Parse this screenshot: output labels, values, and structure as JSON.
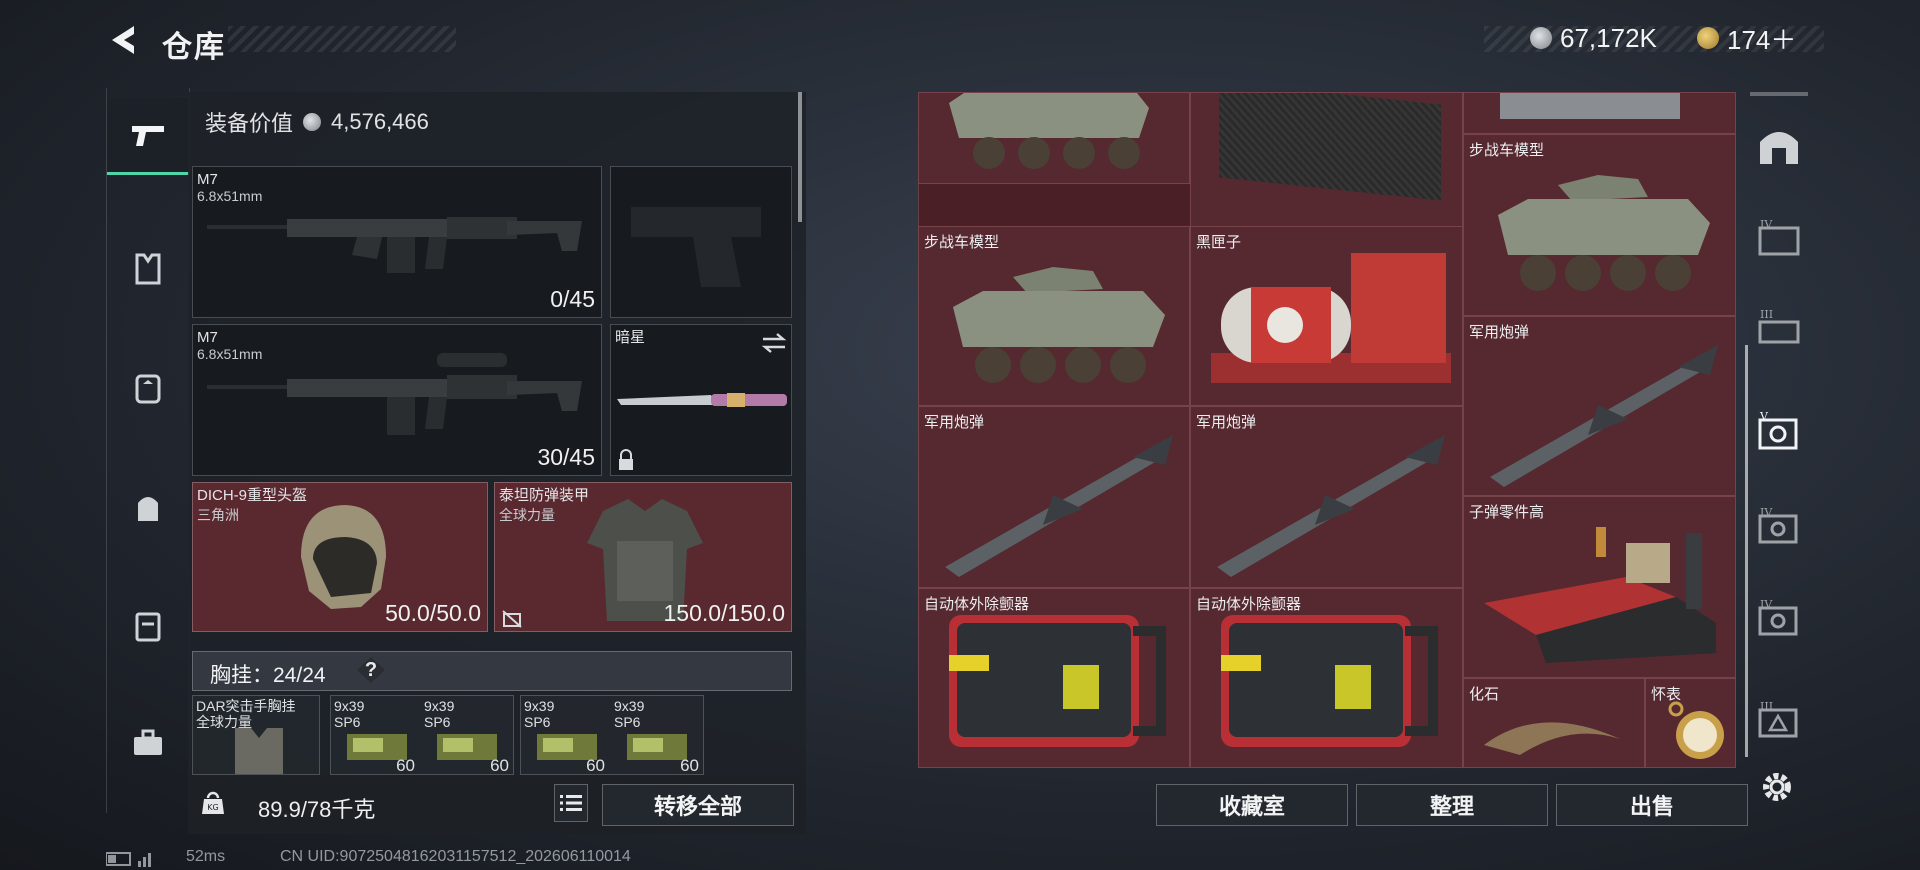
{
  "header": {
    "title": "仓库",
    "currency_main": "67,172K",
    "currency_secondary": "174＋"
  },
  "equipment": {
    "value_label": "装备价值",
    "value": "4,576,466",
    "slots": {
      "primary1": {
        "name": "M7",
        "caliber": "6.8x51mm",
        "ammo": "0/45"
      },
      "primary2": {
        "name": "M7",
        "caliber": "6.8x51mm",
        "ammo": "30/45"
      },
      "melee": {
        "name": "暗星"
      },
      "helmet": {
        "name": "DICH-9重型头盔",
        "sub": "三角洲",
        "durability": "50.0/50.0"
      },
      "armor": {
        "name": "泰坦防弹装甲",
        "sub": "全球力量",
        "durability": "150.0/150.0"
      }
    },
    "vest": {
      "label": "胸挂：",
      "capacity": "24/24",
      "help": "?"
    },
    "vest_items": [
      {
        "name": "DAR突击手胸挂",
        "sub": "全球力量"
      },
      {
        "name": "9x39",
        "sub": "SP6",
        "qty": "60"
      },
      {
        "name": "9x39",
        "sub": "SP6",
        "qty": "60"
      },
      {
        "name": "9x39",
        "sub": "SP6",
        "qty": "60"
      },
      {
        "name": "9x39",
        "sub": "SP6",
        "qty": "60"
      }
    ],
    "weight": "89.9/78千克",
    "transfer_all": "转移全部"
  },
  "storage": {
    "items": [
      {
        "label": "步战车模型"
      },
      {
        "label": "步战车模型"
      },
      {
        "label": "黑匣子"
      },
      {
        "label": "军用炮弹"
      },
      {
        "label": "军用炮弹"
      },
      {
        "label": "军用炮弹"
      },
      {
        "label": "子弹零件高"
      },
      {
        "label": "自动体外除颤器"
      },
      {
        "label": "自动体外除颤器"
      },
      {
        "label": "化石"
      },
      {
        "label": "怀表"
      }
    ]
  },
  "actions": {
    "collection": "收藏室",
    "organize": "整理",
    "sell": "出售"
  },
  "status": {
    "ping": "52ms",
    "uid": "CN UID:90725048162031157512_202606110014"
  },
  "colors": {
    "accent": "#4fd6a8",
    "item_bg": "#562830"
  }
}
